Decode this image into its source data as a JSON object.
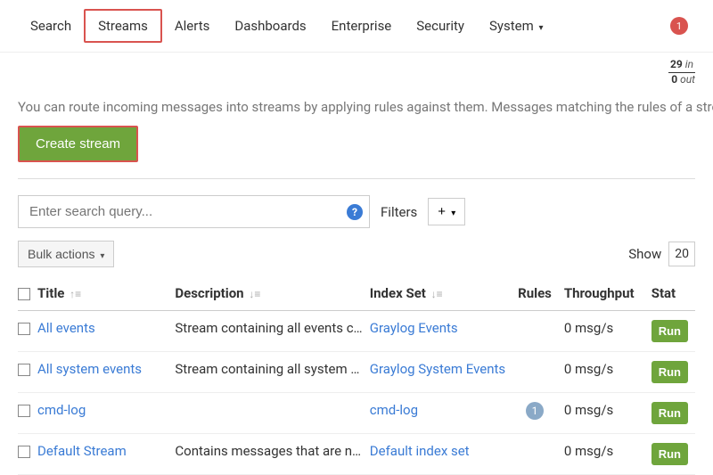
{
  "nav": {
    "items": [
      "Search",
      "Streams",
      "Alerts",
      "Dashboards",
      "Enterprise",
      "Security",
      "System"
    ],
    "active": "Streams",
    "notif_count": "1"
  },
  "stats": {
    "in_count": "29",
    "in_label": "in",
    "out_count": "0",
    "out_label": "out"
  },
  "description": "You can route incoming messages into streams by applying rules against them. Messages matching the rules of a stream it. A message can also be routed into multiple streams.",
  "buttons": {
    "create_stream": "Create stream",
    "bulk_actions": "Bulk actions",
    "add_filter": "+"
  },
  "search": {
    "placeholder": "Enter search query...",
    "filters_label": "Filters"
  },
  "pagination": {
    "show_label": "Show",
    "page_size": "20"
  },
  "table": {
    "headers": {
      "title": "Title",
      "description": "Description",
      "index_set": "Index Set",
      "rules": "Rules",
      "throughput": "Throughput",
      "status": "Stat"
    },
    "rows": [
      {
        "title": "All events",
        "description": "Stream containing all events cr…",
        "index_set": "Graylog Events",
        "rules": "",
        "throughput": "0 msg/s",
        "status": "Run"
      },
      {
        "title": "All system events",
        "description": "Stream containing all system e…",
        "index_set": "Graylog System Events",
        "rules": "",
        "throughput": "0 msg/s",
        "status": "Run"
      },
      {
        "title": "cmd-log",
        "description": "",
        "index_set": "cmd-log",
        "rules": "1",
        "throughput": "0 msg/s",
        "status": "Run"
      },
      {
        "title": "Default Stream",
        "description": "Contains messages that are no…",
        "index_set": "Default index set",
        "rules": "",
        "throughput": "0 msg/s",
        "status": "Run"
      }
    ]
  }
}
